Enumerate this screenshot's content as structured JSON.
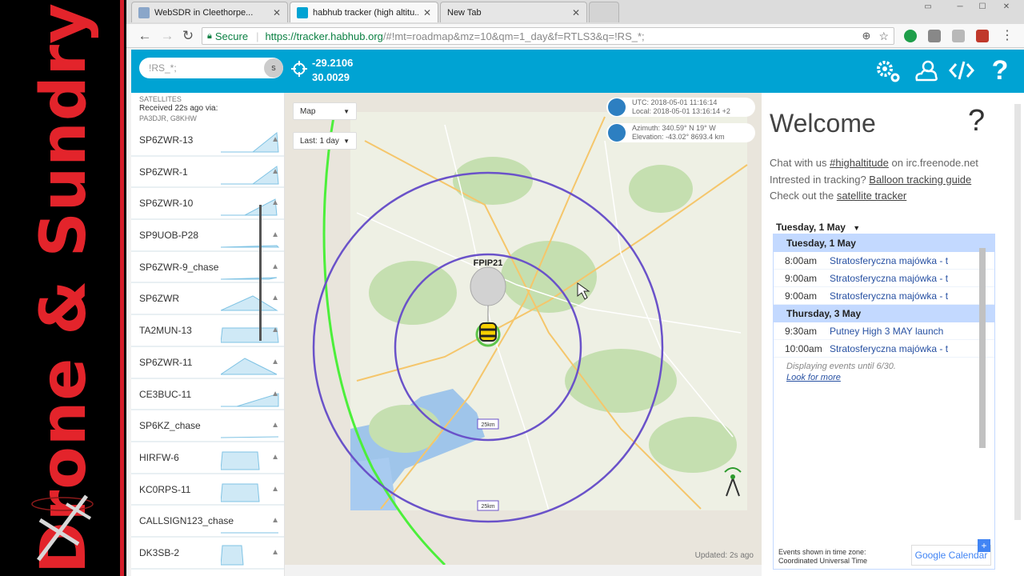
{
  "branding": {
    "text": "Drone & Sundry",
    "colors": {
      "accent": "#e3242b",
      "background": "#000000"
    }
  },
  "browser": {
    "tabs": [
      {
        "label": "WebSDR in Cleethorpe...",
        "icon": "websdr-favicon-icon",
        "active": false
      },
      {
        "label": "habhub tracker (high altitu...",
        "icon": "habhub-favicon-icon",
        "active": true
      },
      {
        "label": "New Tab",
        "icon": "",
        "active": false
      }
    ],
    "address": {
      "secure_label": "Secure",
      "url_host": "https://tracker.habhub.org",
      "url_rest": "/#!mt=roadmap&mz=10&qm=1_day&f=RTLS3&q=!RS_*;"
    }
  },
  "header": {
    "search": {
      "value": "!RS_*;",
      "button_label": "s"
    },
    "coords": {
      "lat": "-29.2106",
      "lon": "30.0029"
    },
    "icons": [
      "settings-gears-icon",
      "weather-icon",
      "embed-code-icon",
      "help-icon"
    ],
    "accent_color": "#00a3d3"
  },
  "sidebar": {
    "header": {
      "title": "SATELLITES",
      "received": "Received 22s ago via:",
      "via": "PA3DJR, G8KHW"
    },
    "items": [
      {
        "name": "SP6ZWR-13"
      },
      {
        "name": "SP6ZWR-1"
      },
      {
        "name": "SP6ZWR-10"
      },
      {
        "name": "SP9UOB-P28"
      },
      {
        "name": "SP6ZWR-9_chase"
      },
      {
        "name": "SP6ZWR"
      },
      {
        "name": "TA2MUN-13"
      },
      {
        "name": "SP6ZWR-11"
      },
      {
        "name": "CE3BUC-11"
      },
      {
        "name": "SP6KZ_chase"
      },
      {
        "name": "HIRFW-6"
      },
      {
        "name": "KC0RPS-11"
      },
      {
        "name": "CALLSIGN123_chase"
      },
      {
        "name": "DK3SB-2"
      }
    ]
  },
  "map": {
    "map_type": "Map",
    "time_range": "Last: 1 day",
    "time": {
      "utc": "UTC: 2018-05-01 11:16:14",
      "local": "Local: 2018-05-01 13:16:14 +2"
    },
    "azel": {
      "azimuth": "Azimuth: 340.59°  N 19° W",
      "elevation": "Elevation: -43.02°  8693.4 km"
    },
    "balloon_label": "FPIP21",
    "range_labels": [
      "25km",
      "25km"
    ],
    "updated": "Updated: 2s ago"
  },
  "right_panel": {
    "title": "Welcome",
    "help": "?",
    "chat_prefix": "Chat with us ",
    "chat_channel": "#highaltitude",
    "chat_suffix": " on irc.freenode.net",
    "tracking_prefix": "Intrested in tracking? ",
    "tracking_link": "Balloon tracking guide",
    "sat_prefix": "Check out the ",
    "sat_link": "satellite tracker",
    "calendar": {
      "toolbar_date": "Tuesday, 1 May",
      "days": [
        {
          "label": "Tuesday, 1 May",
          "events": [
            {
              "time": "8:00am",
              "title": "Stratosferyczna majówka - t"
            },
            {
              "time": "9:00am",
              "title": "Stratosferyczna majówka - t"
            },
            {
              "time": "9:00am",
              "title": "Stratosferyczna majówka - t"
            }
          ]
        },
        {
          "label": "Thursday, 3 May",
          "events": [
            {
              "time": "9:30am",
              "title": "Putney High 3 MAY launch"
            },
            {
              "time": "10:00am",
              "title": "Stratosferyczna majówka - t"
            }
          ]
        }
      ],
      "displaying": "Displaying events until 6/30.",
      "look_more": "Look for more",
      "tz_line1": "Events shown in time zone:",
      "tz_line2": "Coordinated Universal Time",
      "gcal_label": "Google Calendar"
    }
  }
}
